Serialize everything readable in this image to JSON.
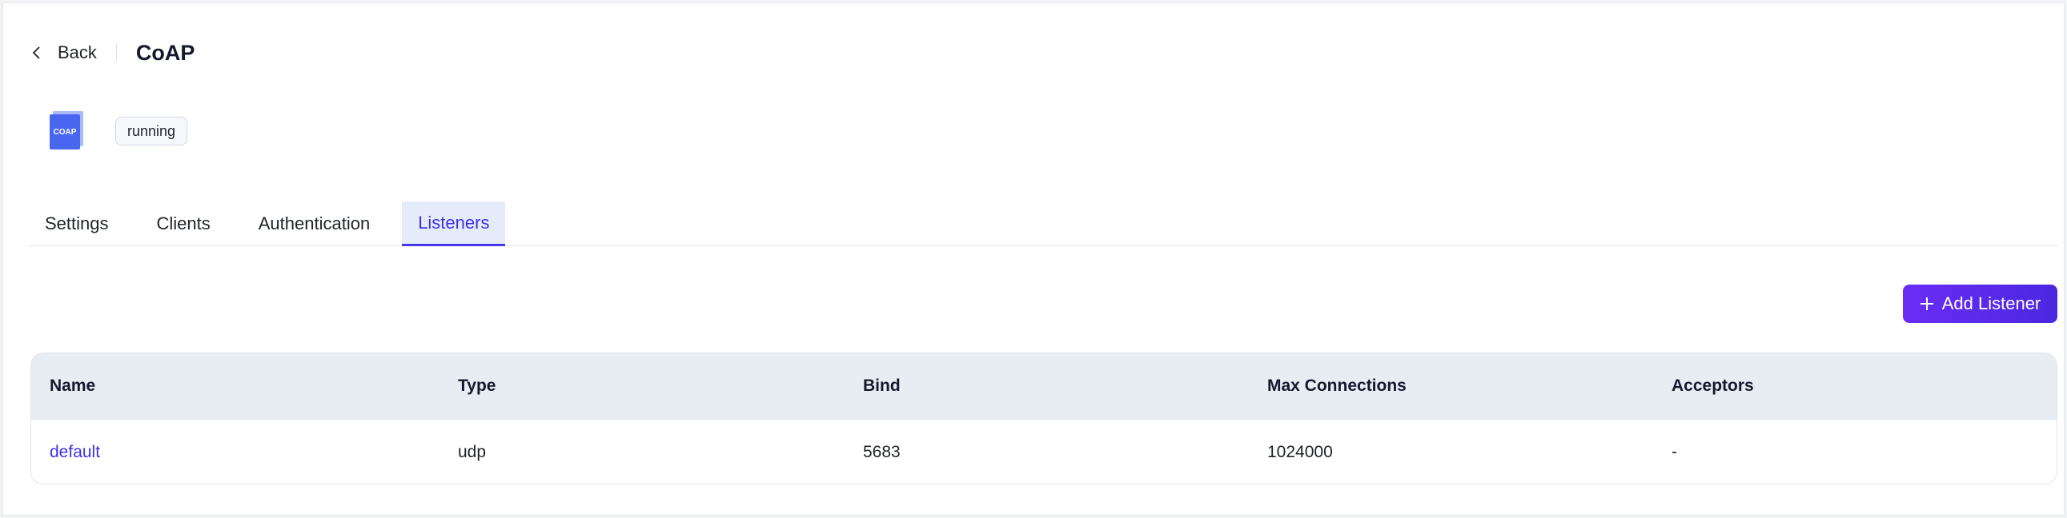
{
  "header": {
    "back_label": "Back",
    "title": "CoAP"
  },
  "gateway": {
    "logo_text": "COAP",
    "status": "running"
  },
  "tabs": [
    {
      "label": "Settings",
      "active": false
    },
    {
      "label": "Clients",
      "active": false
    },
    {
      "label": "Authentication",
      "active": false
    },
    {
      "label": "Listeners",
      "active": true
    }
  ],
  "add_button": {
    "label": "Add Listener"
  },
  "table": {
    "columns": [
      "Name",
      "Type",
      "Bind",
      "Max Connections",
      "Acceptors"
    ],
    "rows": [
      {
        "name": "default",
        "type": "udp",
        "bind": "5683",
        "max_connections": "1024000",
        "acceptors": "-"
      }
    ]
  },
  "colors": {
    "accent": "#3d32e6",
    "button_gradient_start": "#6b2cf5",
    "button_gradient_end": "#4b27e0",
    "table_header_bg": "#e8ecf3"
  }
}
